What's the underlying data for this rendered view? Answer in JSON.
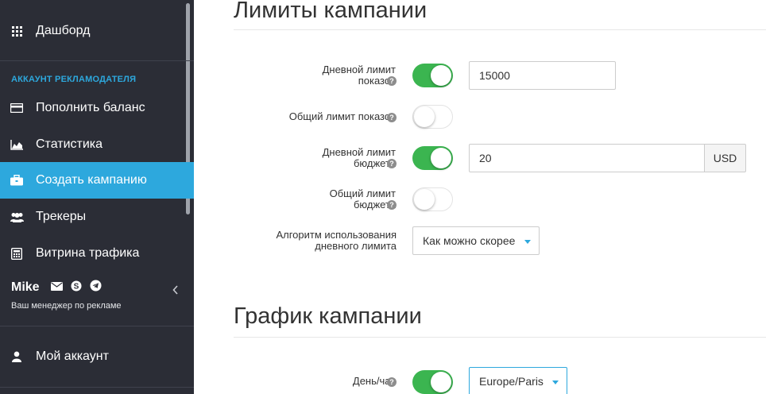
{
  "sidebar": {
    "items": [
      {
        "label": "Дашборд",
        "icon": "grid-icon"
      },
      {
        "label": "Пополнить баланс",
        "icon": "credit-card-icon"
      },
      {
        "label": "Статистика",
        "icon": "area-chart-icon"
      },
      {
        "label": "Создать кампанию",
        "icon": "briefcase-icon",
        "active": true
      },
      {
        "label": "Трекеры",
        "icon": "users-icon"
      },
      {
        "label": "Витрина трафика",
        "icon": "calculator-icon"
      },
      {
        "label": "Мой аккаунт",
        "icon": "user-icon"
      }
    ],
    "section_title": "АККАУНТ РЕКЛАМОДАТЕЛЯ",
    "manager": {
      "name": "Mike",
      "subtitle": "Ваш менеджер по рекламе",
      "contact_icons": [
        "envelope-icon",
        "skype-icon",
        "telegram-icon"
      ]
    }
  },
  "limits": {
    "title": "Лимиты кампании",
    "daily_impressions": {
      "label_line1": "Дневной лимит",
      "label_line2": "показов",
      "enabled": true,
      "value": "15000"
    },
    "total_impressions": {
      "label": "Общий лимит показов",
      "enabled": false
    },
    "daily_budget": {
      "label_line1": "Дневной лимит",
      "label_line2": "бюджета",
      "enabled": true,
      "value": "20",
      "currency": "USD"
    },
    "total_budget": {
      "label_line1": "Общий лимит",
      "label_line2": "бюджета",
      "enabled": false
    },
    "algorithm": {
      "label_line1": "Алгоритм использования",
      "label_line2": "дневного лимита",
      "selected": "Как можно скорее"
    }
  },
  "schedule": {
    "title": "График кампании",
    "dayhour": {
      "label": "День/час",
      "enabled": true,
      "timezone": "Europe/Paris"
    }
  },
  "colors": {
    "sidebar_bg": "#2b2d36",
    "accent": "#2da8dd",
    "toggle_on": "#3bb550"
  }
}
